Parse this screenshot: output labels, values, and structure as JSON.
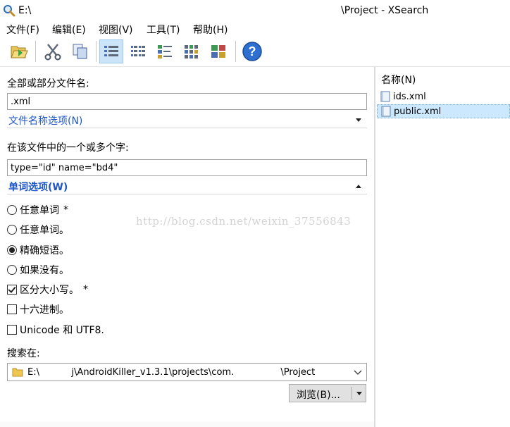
{
  "window": {
    "path": "E:\\",
    "title": "\\Project - XSearch"
  },
  "menu": [
    {
      "label": "文件(F)"
    },
    {
      "label": "编辑(E)"
    },
    {
      "label": "视图(V)"
    },
    {
      "label": "工具(T)"
    },
    {
      "label": "帮助(H)"
    }
  ],
  "toolbar": {
    "buttons": [
      {
        "icon": "open-folder-icon"
      },
      {
        "icon": "cut-icon"
      },
      {
        "icon": "copy-icon"
      },
      {
        "icon": "details-view-icon",
        "active": true
      },
      {
        "icon": "list-view-icon"
      },
      {
        "icon": "small-icons-view-icon"
      },
      {
        "icon": "tiles-view-icon"
      },
      {
        "icon": "large-icons-view-icon"
      },
      {
        "icon": "help-icon"
      }
    ]
  },
  "search": {
    "filename_label": "全部或部分文件名:",
    "filename_value": ".xml",
    "filename_options": "文件名称选项(N)",
    "content_label": "在该文件中的一个或多个字:",
    "content_value": "type=\"id\" name=\"bd4\"",
    "word_options": "单词选项(W)",
    "options": [
      {
        "kind": "radio",
        "label": "任意单词",
        "checked": false,
        "star": "*"
      },
      {
        "kind": "radio",
        "label": "任意单词。",
        "checked": false,
        "star": ""
      },
      {
        "kind": "radio",
        "label": "精确短语。",
        "checked": true,
        "star": ""
      },
      {
        "kind": "radio",
        "label": "如果没有。",
        "checked": false,
        "star": ""
      },
      {
        "kind": "check",
        "label": "区分大小写。",
        "checked": true,
        "star": "*"
      },
      {
        "kind": "check",
        "label": "十六进制。",
        "checked": false,
        "star": ""
      },
      {
        "kind": "check",
        "label": "Unicode 和 UTF8.",
        "checked": false,
        "star": ""
      }
    ],
    "search_in_label": "搜索在:",
    "search_in_value": "E:\\           j\\AndroidKiller_v1.3.1\\projects\\com.                \\Project",
    "browse_label": "浏览(B)..."
  },
  "watermark": "http://blog.csdn.net/weixin_37556843",
  "results": {
    "column_header": "名称(N)",
    "files": [
      {
        "name": "ids.xml",
        "selected": false
      },
      {
        "name": "public.xml",
        "selected": true
      }
    ]
  },
  "colors": {
    "section_link": "#1e56c4",
    "selection": "#cce8ff",
    "active_tool": "#cce4f7"
  }
}
